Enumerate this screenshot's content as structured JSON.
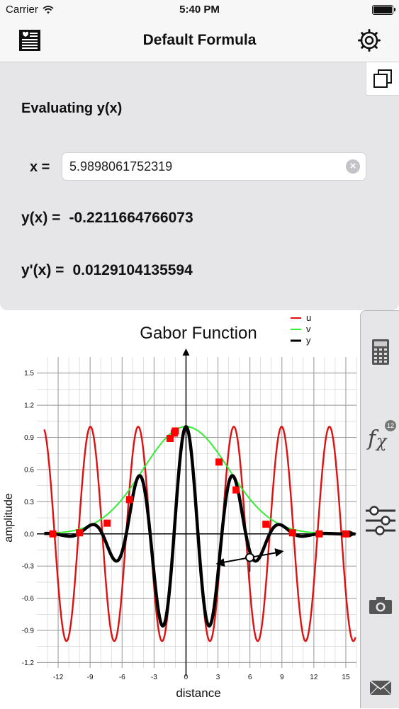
{
  "status_bar": {
    "carrier": "Carrier",
    "time": "5:40 PM"
  },
  "nav": {
    "title": "Default Formula",
    "left_icon": "formula-list-icon",
    "right_icon": "gear-icon"
  },
  "eval": {
    "heading": "Evaluating y(x)",
    "x_label": "x =",
    "x_value": "5.9898061752319",
    "y_label": "y(x) =",
    "y_value": "-0.2211664766073",
    "yprime_label": "y'(x) =",
    "yprime_value": "0.0129104135594",
    "copy_icon": "copy-icon",
    "clear_icon": "clear-icon"
  },
  "toolbar": {
    "items": [
      {
        "icon": "calculator-icon"
      },
      {
        "icon": "function-icon",
        "badge": "12"
      },
      {
        "icon": "sliders-icon"
      },
      {
        "icon": "camera-icon"
      },
      {
        "icon": "mail-icon"
      }
    ]
  },
  "colors": {
    "u": "#dd1111",
    "v": "#33ee33",
    "y": "#000000",
    "marker": "#ff0000",
    "panel": "#e6e6e9"
  },
  "chart_data": {
    "type": "line",
    "title": "Gabor Function",
    "xlabel": "distance",
    "ylabel": "amplitude",
    "xlim": [
      -14,
      16
    ],
    "ylim": [
      -1.25,
      1.65
    ],
    "grid": true,
    "legend_position": "top-right",
    "x_ticks": [
      -12,
      -9,
      -6,
      -3,
      0,
      3,
      6,
      9,
      12,
      15
    ],
    "y_ticks": [
      -1.2,
      -0.9,
      -0.6,
      -0.3,
      0.0,
      0.3,
      0.6,
      0.9,
      1.2,
      1.5
    ],
    "x_tick_labels": [
      "-12",
      "-9",
      "-6",
      "-3",
      "0",
      "3",
      "6",
      "9",
      "12",
      "15"
    ],
    "y_tick_labels": [
      "-1.2",
      "-0.9",
      "-0.6",
      "-0.3",
      "0.0",
      "0.3",
      "0.6",
      "0.9",
      "1.2",
      "1.5"
    ],
    "series": [
      {
        "name": "u",
        "formula": "cos(1.4*x)"
      },
      {
        "name": "v",
        "formula": "exp(-x*x/32)"
      },
      {
        "name": "y",
        "formula": "cos(1.4*x)*exp(-x*x/32)"
      }
    ],
    "markers_u": [
      {
        "x": -12.5,
        "y": 0.0
      },
      {
        "x": -10,
        "y": 0.01
      },
      {
        "x": -7.4,
        "y": 0.1
      },
      {
        "x": -5.3,
        "y": 0.32
      },
      {
        "x": -1.5,
        "y": 0.89
      },
      {
        "x": -1.1,
        "y": 0.94
      },
      {
        "x": -1.0,
        "y": 0.96
      },
      {
        "x": 3.1,
        "y": 0.67
      },
      {
        "x": 4.7,
        "y": 0.41
      },
      {
        "x": 7.5,
        "y": 0.09
      },
      {
        "x": 10,
        "y": 0.01
      },
      {
        "x": 12.5,
        "y": 0.0
      },
      {
        "x": 15,
        "y": 0.0
      }
    ],
    "cursor": {
      "x": 5.99,
      "y": -0.22
    }
  }
}
